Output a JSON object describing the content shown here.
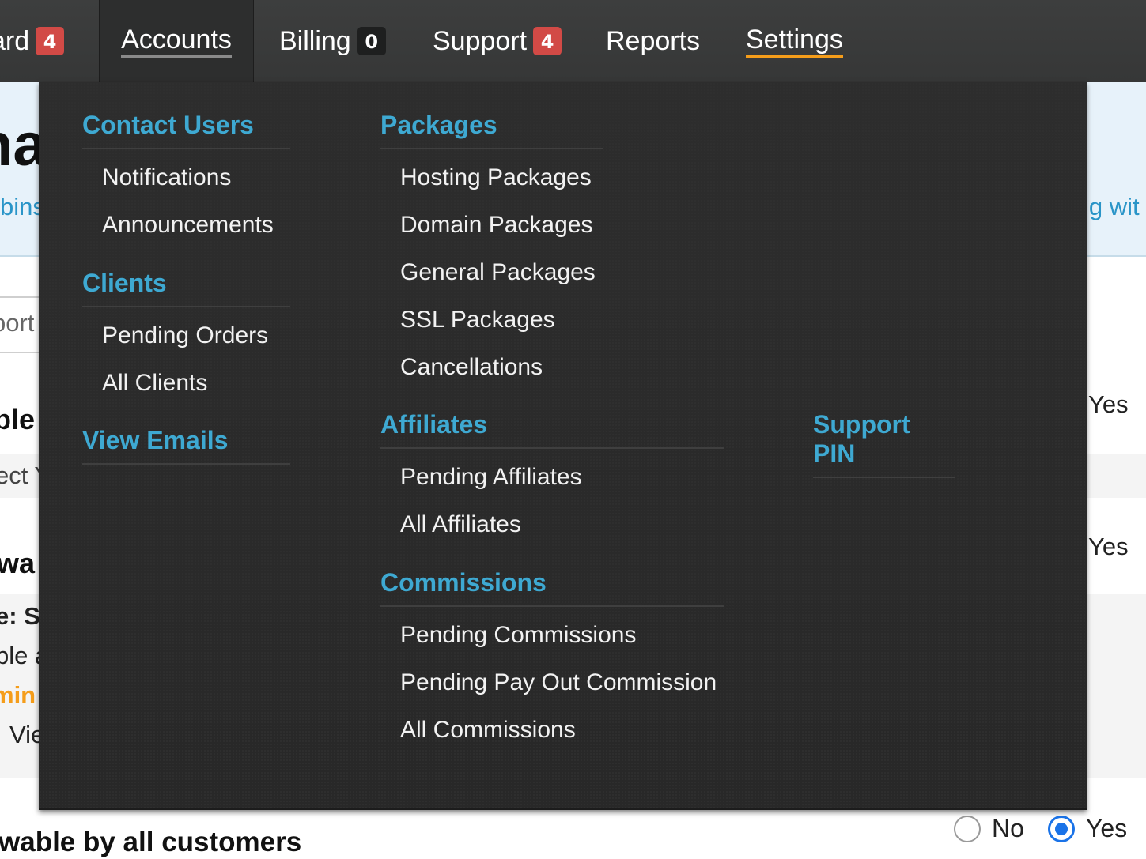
{
  "nav": {
    "items": [
      {
        "label": "ard",
        "badge": "4"
      },
      {
        "label": "Accounts"
      },
      {
        "label": "Billing",
        "badge": "0"
      },
      {
        "label": "Support",
        "badge": "4"
      },
      {
        "label": "Reports"
      },
      {
        "label": "Settings"
      }
    ]
  },
  "background": {
    "hero_title_fragment": "na",
    "hero_link_left_fragment": "bins",
    "hero_link_right_fragment": "ig wit",
    "input_fragment": "port",
    "heading_fragment_1": "ble",
    "select_fragment": "ect Y",
    "heading_fragment_2": "wa",
    "note_fragment_1": "e: S",
    "note_fragment_2": "ble a",
    "note_fragment_3": "min I",
    "note_fragment_4": "Vie",
    "yes_1": "Yes",
    "yes_2": "Yes",
    "bottom_heading": "wable by all customers",
    "radio_no": "No",
    "radio_yes": "Yes",
    "colors": {
      "accent_blue": "#2a95c8",
      "accent_orange": "#f59d1a",
      "radio_blue": "#1a73e8"
    }
  },
  "menu": {
    "col1": [
      {
        "heading": "Contact Users",
        "links": [
          "Notifications",
          "Announcements"
        ]
      },
      {
        "heading": "Clients",
        "links": [
          "Pending Orders",
          "All Clients"
        ]
      },
      {
        "heading": "View Emails",
        "links": []
      }
    ],
    "col2": [
      {
        "heading": "Packages",
        "links": [
          "Hosting Packages",
          "Domain Packages",
          "General Packages",
          "SSL Packages",
          "Cancellations"
        ]
      },
      {
        "heading": "Affiliates",
        "links": [
          "Pending Affiliates",
          "All Affiliates"
        ]
      },
      {
        "heading": "Commissions",
        "links": [
          "Pending Commissions",
          "Pending Pay Out Commission",
          "All Commissions"
        ]
      }
    ],
    "col3": [
      {
        "heading": "Support PIN",
        "links": []
      }
    ],
    "colors": {
      "heading": "#3ea9d2",
      "link": "#f2f2f2",
      "background": "#2b2b2b"
    }
  }
}
